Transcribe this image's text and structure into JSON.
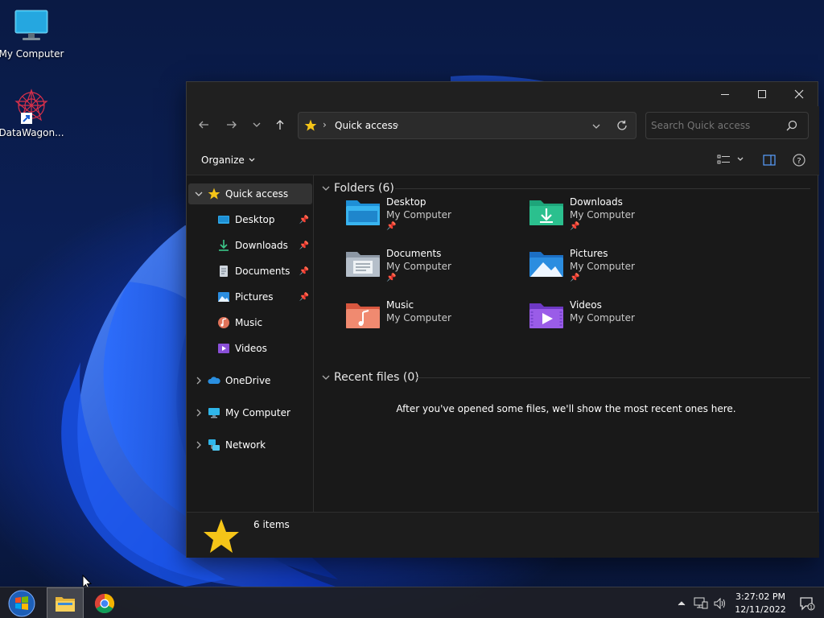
{
  "desktop": {
    "icons": [
      {
        "label": "My Computer",
        "icon": "monitor-icon"
      },
      {
        "label": "DataWagon...",
        "icon": "datawagon-app-icon"
      }
    ]
  },
  "window": {
    "controls": {
      "minimize": "minimize-icon",
      "maximize": "maximize-icon",
      "close": "close-icon"
    },
    "nav": {
      "back": "arrow-left-icon",
      "forward": "arrow-right-icon",
      "recent": "chevron-down-icon",
      "up": "arrow-up-icon"
    },
    "address": {
      "crumb": "Quick access",
      "icon": "star-icon"
    },
    "search": {
      "placeholder": "Search Quick access"
    },
    "toolbar": {
      "organize_label": "Organize"
    },
    "sidebar": {
      "quick_access": "Quick access",
      "items": [
        {
          "label": "Desktop",
          "pinned": true
        },
        {
          "label": "Downloads",
          "pinned": true
        },
        {
          "label": "Documents",
          "pinned": true
        },
        {
          "label": "Pictures",
          "pinned": true
        },
        {
          "label": "Music",
          "pinned": false
        },
        {
          "label": "Videos",
          "pinned": false
        }
      ],
      "roots": [
        {
          "label": "OneDrive"
        },
        {
          "label": "My Computer"
        },
        {
          "label": "Network"
        }
      ]
    },
    "content": {
      "folders_header": "Folders (6)",
      "folders": [
        {
          "name": "Desktop",
          "location": "My Computer",
          "pinned": true
        },
        {
          "name": "Downloads",
          "location": "My Computer",
          "pinned": true
        },
        {
          "name": "Documents",
          "location": "My Computer",
          "pinned": true
        },
        {
          "name": "Pictures",
          "location": "My Computer",
          "pinned": true
        },
        {
          "name": "Music",
          "location": "My Computer",
          "pinned": false
        },
        {
          "name": "Videos",
          "location": "My Computer",
          "pinned": false
        }
      ],
      "recent_header": "Recent files (0)",
      "recent_empty": "After you've opened some files, we'll show the most recent ones here."
    },
    "status": {
      "count": "6 items"
    }
  },
  "taskbar": {
    "time": "3:27:02 PM",
    "date": "12/11/2022"
  },
  "colors": {
    "window_bg": "#191919",
    "chrome_bg": "#202020",
    "accent_star": "#f5c518",
    "desktop_blue": "#1c4fd8"
  }
}
